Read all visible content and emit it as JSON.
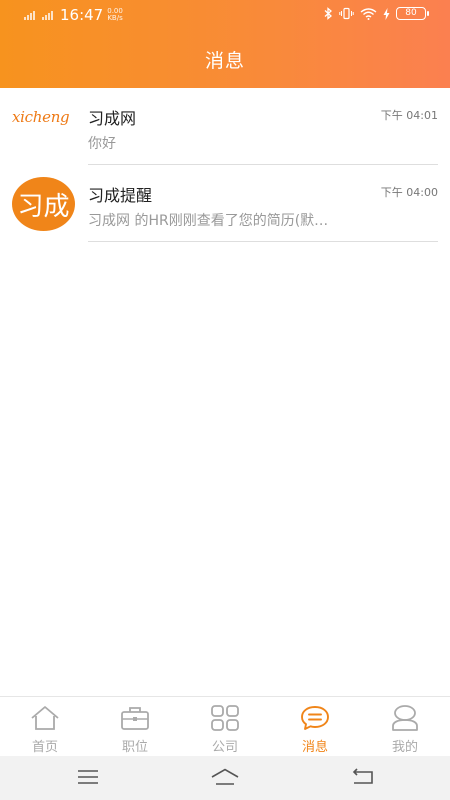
{
  "status_bar": {
    "time": "16:47",
    "speed_value": "0.00",
    "speed_unit": "KB/s",
    "battery": "80"
  },
  "header": {
    "title": "消息"
  },
  "messages": [
    {
      "avatar_text": "xicheng",
      "name": "习成网",
      "preview": "你好",
      "time": "下午 04:01"
    },
    {
      "avatar_text": "习成",
      "name": "习成提醒",
      "preview": "习成网 的HR刚刚查看了您的简历(默…",
      "time": "下午 04:00"
    }
  ],
  "tabs": [
    {
      "label": "首页",
      "icon": "home-icon",
      "active": false
    },
    {
      "label": "职位",
      "icon": "briefcase-icon",
      "active": false
    },
    {
      "label": "公司",
      "icon": "grid-icon",
      "active": false
    },
    {
      "label": "消息",
      "icon": "chat-icon",
      "active": true
    },
    {
      "label": "我的",
      "icon": "user-icon",
      "active": false
    }
  ],
  "colors": {
    "accent": "#f08519",
    "header_start": "#f7931e",
    "header_end": "#fb8050",
    "inactive": "#aaaaaa"
  }
}
